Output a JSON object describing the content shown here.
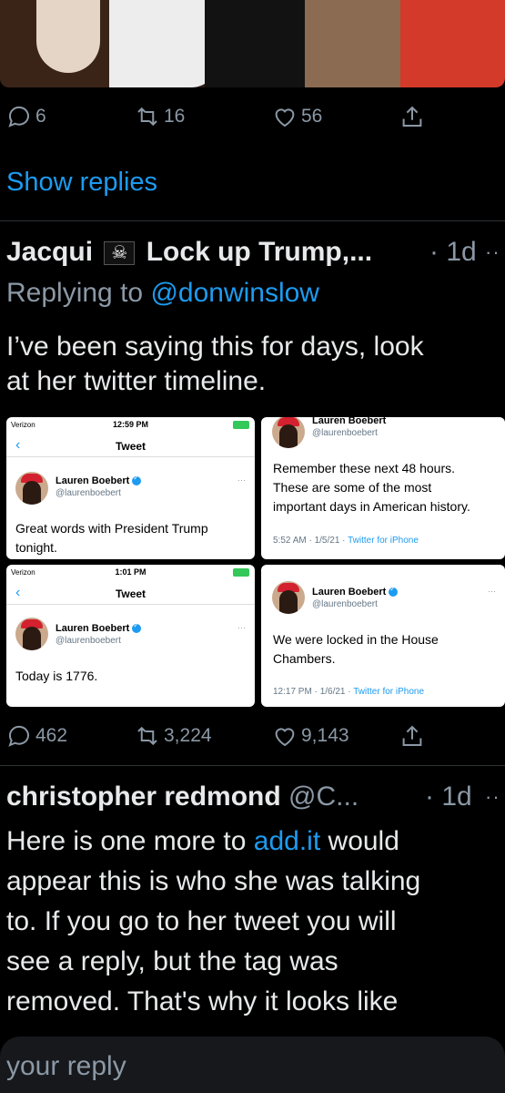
{
  "top_tweet_actions": {
    "replies": "6",
    "retweets": "16",
    "likes": "56"
  },
  "show_replies_label": "Show replies",
  "reply1": {
    "author": "Jacqui",
    "author_suffix": "Lock up Trump,...",
    "time": "· 1d",
    "more": "··",
    "replying_label": "Replying to",
    "replying_handle": "@donwinslow",
    "text_line1": "I’ve been saying this for days, look",
    "text_line2": "at her twitter timeline.",
    "actions": {
      "replies": "462",
      "retweets": "3,224",
      "likes": "9,143"
    }
  },
  "screenshots": {
    "shot1": {
      "carrier": "Verizon",
      "clock": "12:59 PM",
      "nav_title": "Tweet",
      "name": "Lauren Boebert",
      "handle": "@laurenboebert",
      "text_line1": "Great words with President Trump",
      "text_line2": "tonight."
    },
    "shot2": {
      "name": "Lauren Boebert",
      "handle": "@laurenboebert",
      "text_line1": "Remember these next 48 hours.",
      "text_line2": "These are some of the most",
      "text_line3": "important days in American history.",
      "meta_time": "5:52 AM · 1/5/21 ·",
      "meta_source": "Twitter for iPhone"
    },
    "shot3": {
      "carrier": "Verizon",
      "clock": "1:01 PM",
      "nav_title": "Tweet",
      "name": "Lauren Boebert",
      "handle": "@laurenboebert",
      "text": "Today is 1776."
    },
    "shot4": {
      "name": "Lauren Boebert",
      "handle": "@laurenboebert",
      "text_line1": "We were locked in the House",
      "text_line2": "Chambers.",
      "meta_time": "12:17 PM · 1/6/21 ·",
      "meta_source": "Twitter for iPhone"
    }
  },
  "reply2": {
    "author": "christopher redmond",
    "handle": "@C...",
    "time": "· 1d",
    "more": "··",
    "line1_a": "Here is one more to ",
    "line1_link": "add.it",
    "line1_b": " would",
    "line2": "appear this is who she was talking",
    "line3": "to. If you go to her tweet you will",
    "line4": "see a reply, but the tag was",
    "line5": "removed. That's why it looks like"
  },
  "reply_input": {
    "placeholder": "your reply"
  },
  "colors": {
    "background": "#000000",
    "accent": "#1d9bf0",
    "muted": "#8b98a5"
  }
}
